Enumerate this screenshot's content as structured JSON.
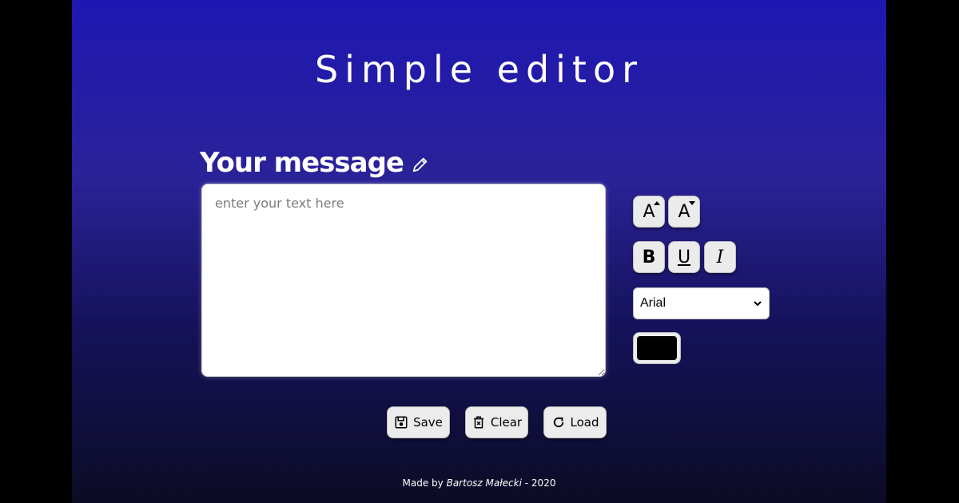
{
  "title": "Simple editor",
  "message_label": "Your message",
  "editor": {
    "placeholder": "enter your text here",
    "value": ""
  },
  "toolbar": {
    "font_increase_label": "A",
    "font_decrease_label": "A",
    "bold_label": "B",
    "underline_label": "U",
    "italic_label": "I",
    "font_family_selected": "Arial",
    "text_color": "#000000"
  },
  "actions": {
    "save_label": "Save",
    "clear_label": "Clear",
    "load_label": "Load"
  },
  "footer": {
    "prefix": "Made by",
    "author": "Bartosz Małecki",
    "suffix": "- 2020"
  },
  "colors": {
    "gradient_top": "#1e17b3",
    "gradient_bottom": "#0c0c25",
    "button_bg": "#ebebeb"
  },
  "icons": {
    "label": "pencil-icon",
    "save": "floppy-disk-icon",
    "clear": "trash-icon",
    "load": "reload-icon",
    "select": "chevron-down-icon"
  }
}
